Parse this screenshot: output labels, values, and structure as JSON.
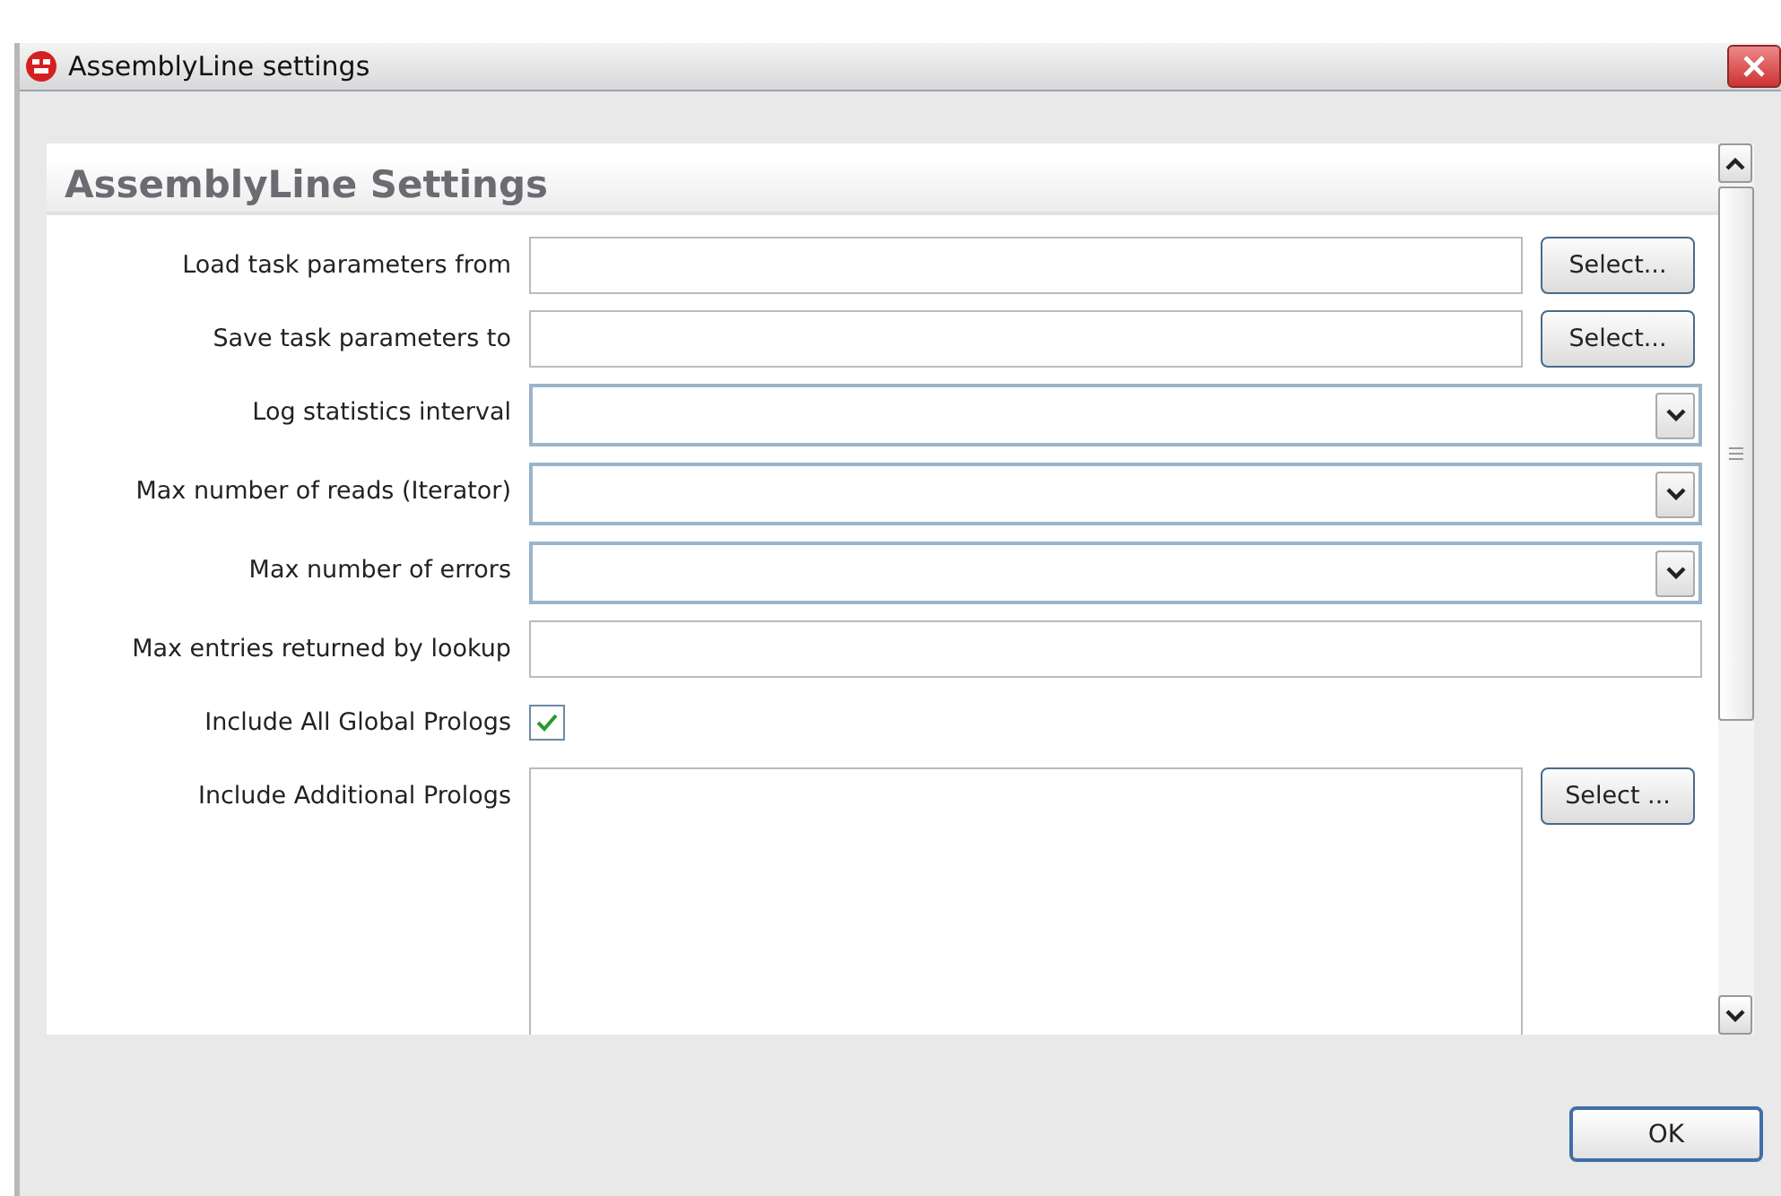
{
  "window": {
    "title": "AssemblyLine settings"
  },
  "panel": {
    "heading": "AssemblyLine Settings"
  },
  "fields": [
    {
      "kind": "file",
      "label": "Load task parameters from",
      "button": "Select..."
    },
    {
      "kind": "file",
      "label": "Save task parameters to",
      "button": "Select..."
    },
    {
      "kind": "combo",
      "label": "Log statistics interval"
    },
    {
      "kind": "combo",
      "label": "Max number of reads (Iterator)"
    },
    {
      "kind": "combo",
      "label": "Max number of errors"
    },
    {
      "kind": "text",
      "label": "Max entries returned by lookup"
    },
    {
      "kind": "checkbox",
      "label": "Include All Global Prologs",
      "checked": true
    },
    {
      "kind": "list",
      "label": "Include Additional Prologs",
      "button": "Select ..."
    }
  ],
  "buttons": [
    "OK"
  ]
}
